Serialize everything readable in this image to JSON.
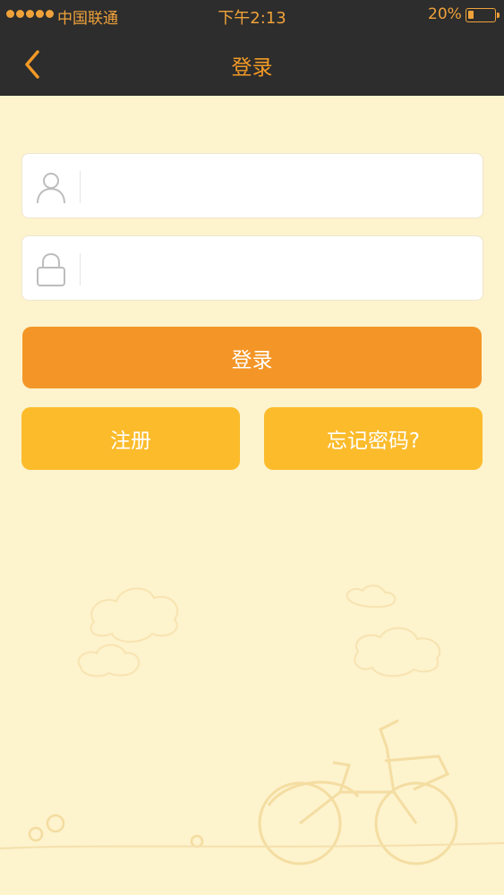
{
  "status_bar": {
    "carrier": "中国联通",
    "time": "下午2:13",
    "battery_percent": "20%",
    "battery_level": 0.2
  },
  "nav": {
    "back_icon": "chevron-left-icon",
    "title": "登录"
  },
  "form": {
    "username": {
      "icon": "user-icon",
      "value": "",
      "placeholder": ""
    },
    "password": {
      "icon": "lock-icon",
      "value": "",
      "placeholder": ""
    },
    "login_label": "登录",
    "register_label": "注册",
    "forgot_label": "忘记密码?"
  },
  "colors": {
    "header_bg": "#2d2d2d",
    "accent": "#f39a26",
    "page_bg": "#fdf3cd",
    "primary_button": "#f39627",
    "secondary_button": "#fbbb2b"
  }
}
